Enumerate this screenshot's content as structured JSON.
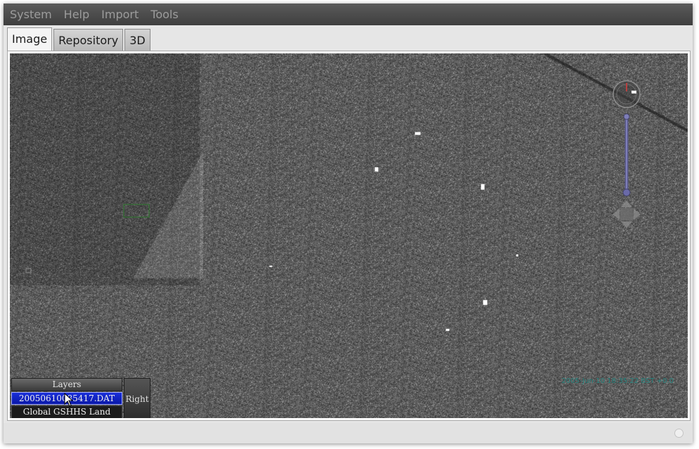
{
  "menubar": {
    "items": [
      "System",
      "Help",
      "Import",
      "Tools"
    ]
  },
  "tabs": [
    {
      "label": "Image",
      "active": true
    },
    {
      "label": "Repository",
      "active": false
    },
    {
      "label": "3D",
      "active": false
    }
  ],
  "viewer": {
    "timestamp": "2005-Jun-10 18:35:22 BST +0.0",
    "layers": {
      "header": "Layers",
      "items": [
        {
          "label": "20050610085417.DAT",
          "selected": true
        },
        {
          "label": "Global GSHHS Land Mask",
          "selected": false
        }
      ]
    },
    "right_button_label": "Right",
    "controls": {
      "compass_icon": "compass-icon",
      "zoom_slider_icon": "zoom-slider-icon",
      "pan_icon": "pan-arrows-icon"
    }
  },
  "colors": {
    "selected_layer": "#1a2fd8",
    "timestamp_text": "#1e8a84",
    "menubar": "#4a4a4a"
  }
}
